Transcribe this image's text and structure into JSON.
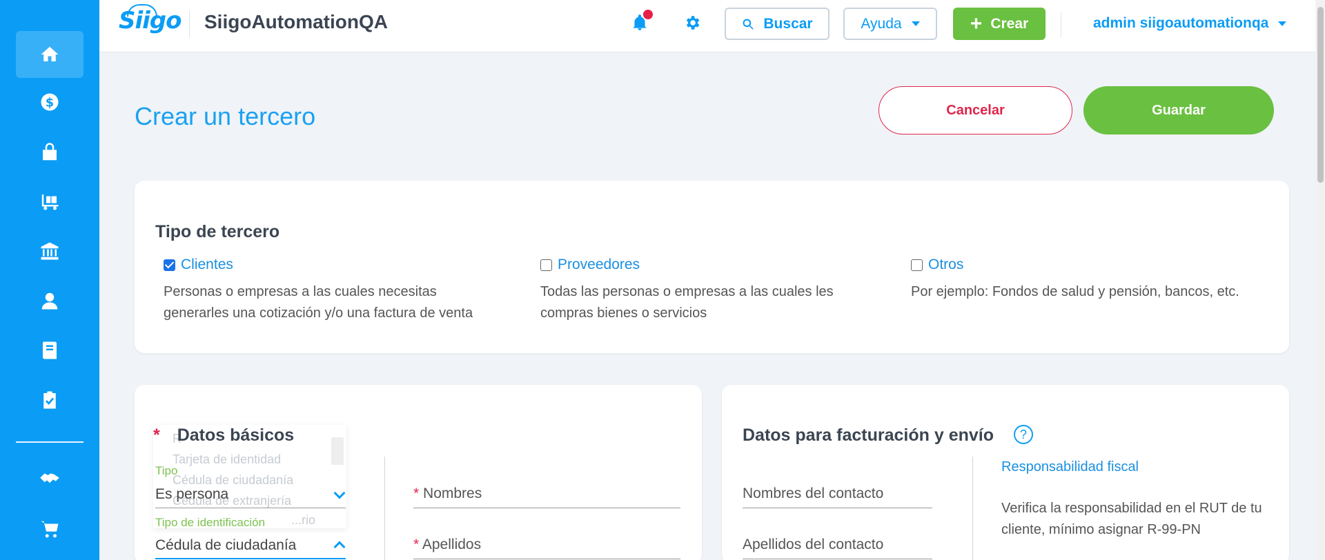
{
  "app": {
    "logo": "Siigo",
    "company": "SiigoAutomationQA"
  },
  "header": {
    "search_label": "Buscar",
    "help_label": "Ayuda",
    "create_label": "Crear",
    "user_label": "admin siigoautomationqa"
  },
  "sidebar": {
    "items": [
      {
        "icon": "home-icon"
      },
      {
        "icon": "dollar-icon"
      },
      {
        "icon": "shopping-bag-icon"
      },
      {
        "icon": "inventory-icon"
      },
      {
        "icon": "bank-icon"
      },
      {
        "icon": "employee-icon"
      },
      {
        "icon": "book-icon"
      },
      {
        "icon": "clipboard-check-icon"
      },
      {
        "icon": "handshake-icon"
      },
      {
        "icon": "cart-icon"
      }
    ]
  },
  "page": {
    "title": "Crear un tercero",
    "cancel_label": "Cancelar",
    "save_label": "Guardar"
  },
  "tipo_tercero": {
    "heading": "Tipo de tercero",
    "options": [
      {
        "label": "Clientes",
        "checked": true,
        "desc_line1": "Personas o empresas a las cuales necesitas",
        "desc_line2": "generarles una cotización y/o una factura de venta"
      },
      {
        "label": "Proveedores",
        "checked": false,
        "desc_line1": "Todas las personas o empresas a las cuales les",
        "desc_line2": "compras bienes o servicios"
      },
      {
        "label": "Otros",
        "checked": false,
        "desc_line1": "Por ejemplo: Fondos de salud y pensión, bancos, etc.",
        "desc_line2": ""
      }
    ]
  },
  "datos_basicos": {
    "required_mark": "*",
    "heading": "Datos básicos",
    "tipo_label": "Tipo",
    "tipo_value": "Es persona",
    "tipo_id_label": "Tipo de identificación",
    "tipo_id_value": "Cédula de ciudadanía",
    "nombres_placeholder": "Nombres",
    "apellidos_placeholder": "Apellidos",
    "dropdown_ghost_items": [
      "R",
      "Tarjeta de identidad",
      "Cédula de ciudadanía",
      "Cédula de extranjería",
      "...rio"
    ]
  },
  "facturacion": {
    "heading": "Datos para facturación y envío",
    "help_glyph": "?",
    "contact_names_placeholder": "Nombres del contacto",
    "contact_lastnames_placeholder": "Apellidos del contacto",
    "resp_link": "Responsabilidad fiscal",
    "resp_desc": "Verifica la responsabilidad en el RUT de tu cliente, mínimo asignar R-99-PN"
  },
  "colors": {
    "brand_blue": "#0b9cf5",
    "green": "#6ac040",
    "red": "#e0254c"
  }
}
